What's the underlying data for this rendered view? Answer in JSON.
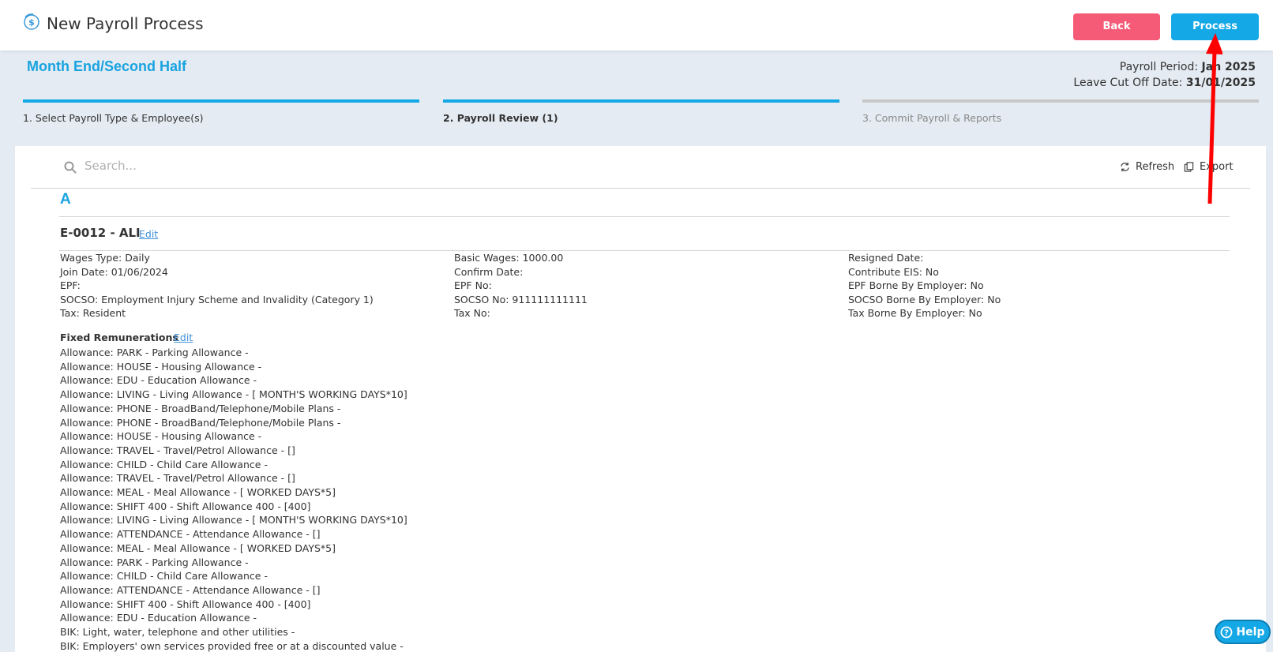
{
  "header": {
    "title": "New Payroll Process",
    "back_label": "Back",
    "process_label": "Process"
  },
  "subheader": {
    "section_title": "Month End/Second Half",
    "payroll_period_label": "Payroll Period: ",
    "payroll_period_value": "Jan 2025",
    "leave_cutoff_label": "Leave Cut Off Date: ",
    "leave_cutoff_value": "31/01/2025"
  },
  "steps": [
    {
      "label": "1. Select Payroll Type & Employee(s)",
      "state": "complete"
    },
    {
      "label": "2. Payroll Review (1)",
      "state": "active"
    },
    {
      "label": "3. Commit Payroll & Reports",
      "state": "pending"
    }
  ],
  "toolbar": {
    "search_placeholder": "Search...",
    "refresh_label": "Refresh",
    "export_label": "Export"
  },
  "group_letter": "A",
  "employee": {
    "title": "E-0012 - ALI",
    "edit_label": "Edit",
    "col1": [
      "Wages Type: Daily",
      "Join Date: 01/06/2024",
      "EPF:",
      "SOCSO: Employment Injury Scheme and Invalidity (Category 1)",
      "Tax: Resident"
    ],
    "col2": [
      "Basic Wages: 1000.00",
      "Confirm Date:",
      "EPF No:",
      "SOCSO No: 911111111111",
      "Tax No:"
    ],
    "col3": [
      "Resigned Date:",
      "Contribute EIS: No",
      "EPF Borne By Employer: No",
      "SOCSO Borne By Employer: No",
      "Tax Borne By Employer: No"
    ]
  },
  "remunerations": {
    "heading": "Fixed Remunerations",
    "edit_label": "Edit",
    "items": [
      "Allowance: PARK - Parking Allowance -",
      "Allowance: HOUSE - Housing Allowance -",
      "Allowance: EDU - Education Allowance -",
      "Allowance: LIVING - Living Allowance - [ MONTH'S WORKING DAYS*10]",
      "Allowance: PHONE - BroadBand/Telephone/Mobile Plans -",
      "Allowance: PHONE - BroadBand/Telephone/Mobile Plans -",
      "Allowance: HOUSE - Housing Allowance -",
      "Allowance: TRAVEL - Travel/Petrol Allowance - []",
      "Allowance: CHILD - Child Care Allowance -",
      "Allowance: TRAVEL - Travel/Petrol Allowance - []",
      "Allowance: MEAL - Meal Allowance - [ WORKED DAYS*5]",
      "Allowance: SHIFT 400 - Shift Allowance 400 - [400]",
      "Allowance: LIVING - Living Allowance - [ MONTH'S WORKING DAYS*10]",
      "Allowance: ATTENDANCE - Attendance Allowance - []",
      "Allowance: MEAL - Meal Allowance - [ WORKED DAYS*5]",
      "Allowance: PARK - Parking Allowance -",
      "Allowance: CHILD - Child Care Allowance -",
      "Allowance: ATTENDANCE - Attendance Allowance - []",
      "Allowance: SHIFT 400 - Shift Allowance 400 - [400]",
      "Allowance: EDU - Education Allowance -",
      "BIK: Light, water, telephone and other utilities -",
      "BIK: Employers' own services provided free or at a discounted value -"
    ]
  },
  "help_label": "Help",
  "colors": {
    "accent": "#14a8e6",
    "back_button": "#f55a76",
    "annotation_arrow": "#ff0000"
  }
}
